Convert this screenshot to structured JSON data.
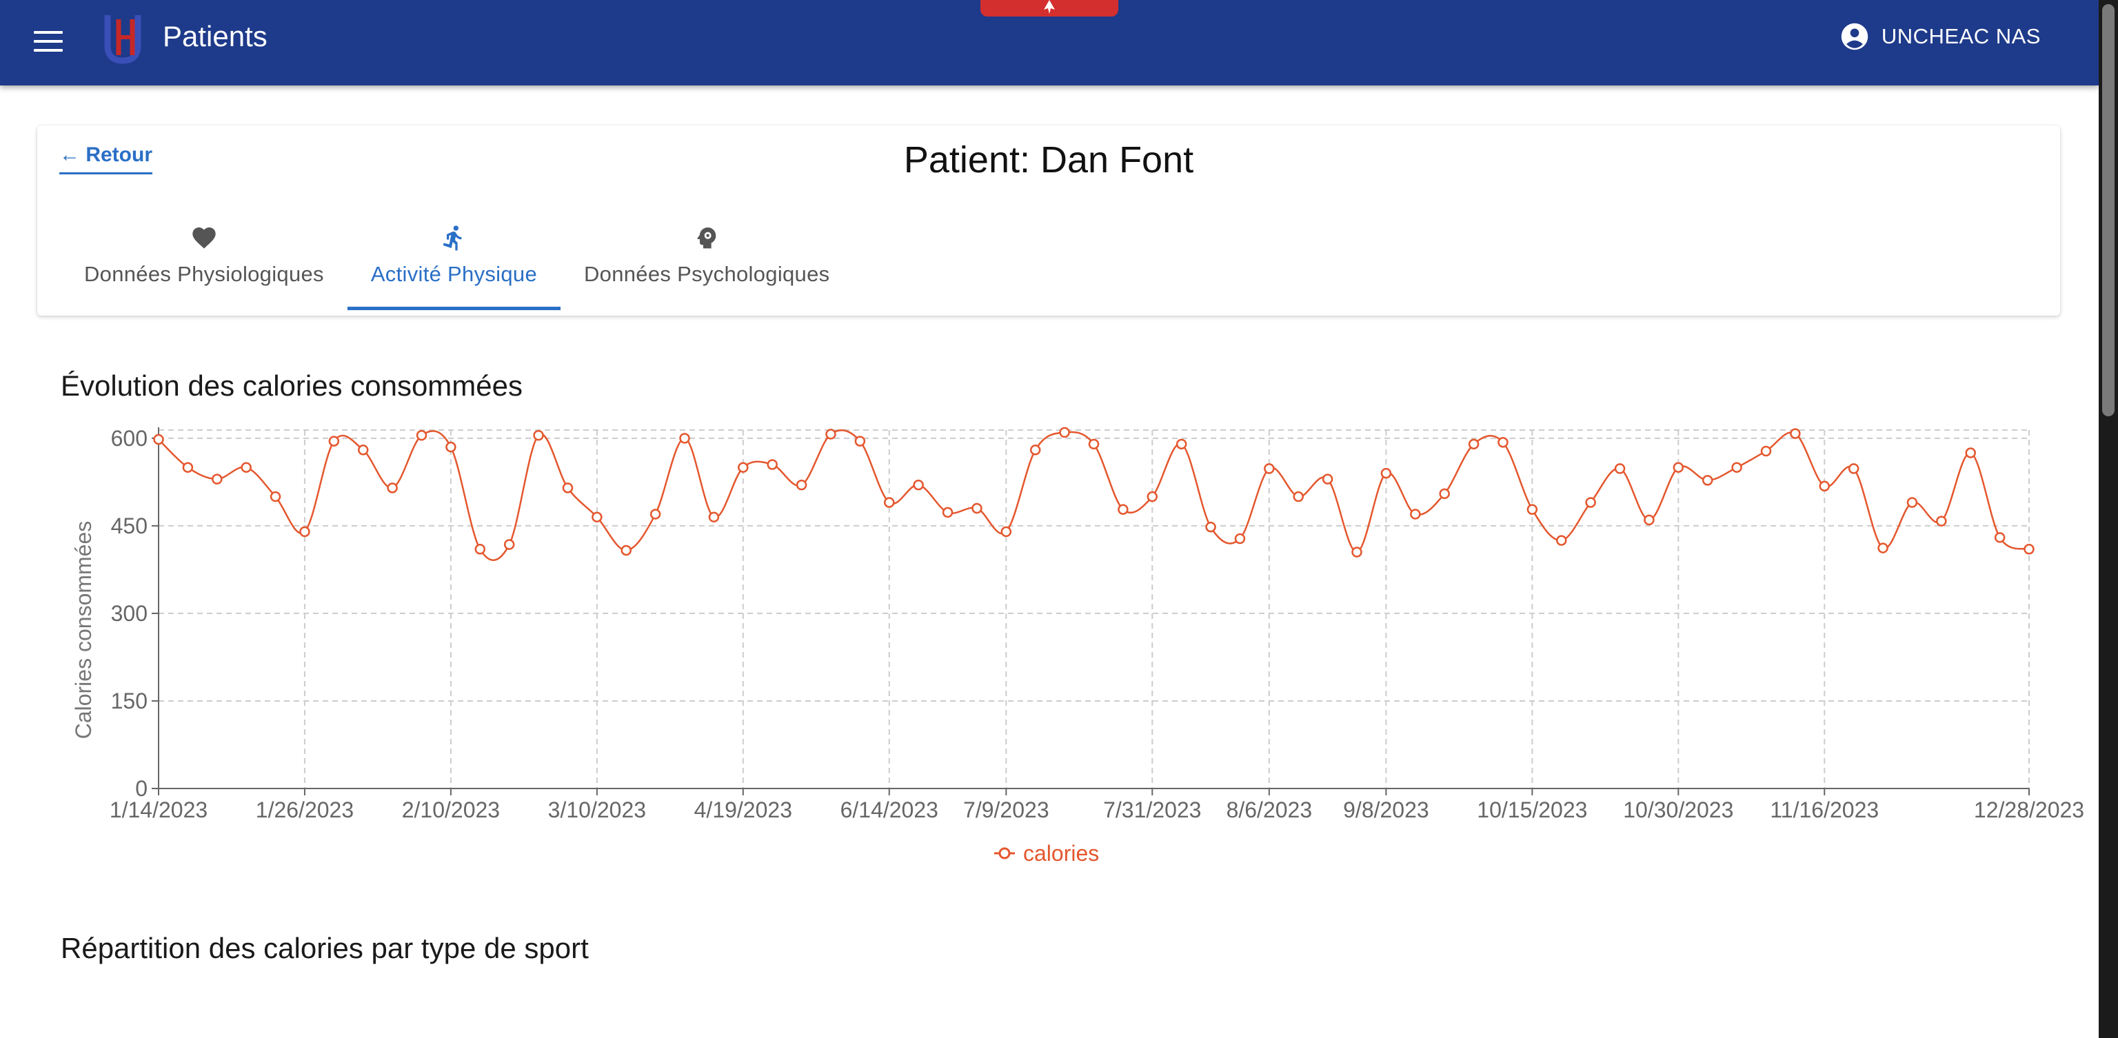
{
  "app": {
    "title": "Patients",
    "user_name": "UNCHEAC NAS",
    "bar_color": "#1e3a8a"
  },
  "header": {
    "back_label": "← Retour",
    "patient_title": "Patient: Dan Font",
    "tabs": [
      {
        "label": "Données Physiologiques",
        "icon": "heart-icon",
        "active": false
      },
      {
        "label": "Activité Physique",
        "icon": "running-icon",
        "active": true
      },
      {
        "label": "Données Psychologiques",
        "icon": "psychology-icon",
        "active": false
      }
    ]
  },
  "sections": {
    "calories_title": "Évolution des calories consommées",
    "sport_title": "Répartition des calories par type de sport"
  },
  "chart_data": {
    "type": "line",
    "title": "",
    "ylabel": "Calories consommées",
    "xlabel": "",
    "ylim": [
      0,
      614
    ],
    "yticks": [
      0,
      150,
      300,
      450,
      600
    ],
    "xtick_labels": [
      "1/14/2023",
      "1/26/2023",
      "2/10/2023",
      "3/10/2023",
      "4/19/2023",
      "6/14/2023",
      "7/9/2023",
      "7/31/2023",
      "8/6/2023",
      "9/8/2023",
      "10/15/2023",
      "10/30/2023",
      "11/16/2023",
      "12/28/2023"
    ],
    "grid": true,
    "legend": "bottom-center",
    "series": [
      {
        "name": "calories",
        "color": "#e4572e",
        "values": [
          598,
          550,
          530,
          550,
          500,
          440,
          595,
          580,
          515,
          605,
          585,
          410,
          418,
          605,
          515,
          465,
          408,
          470,
          600,
          465,
          550,
          555,
          520,
          607,
          595,
          490,
          520,
          473,
          480,
          440,
          580,
          610,
          590,
          478,
          500,
          590,
          448,
          428,
          548,
          500,
          530,
          405,
          540,
          470,
          505,
          590,
          593,
          478,
          425,
          490,
          548,
          460,
          550,
          528,
          550,
          578,
          608,
          518,
          548,
          412,
          490,
          458,
          575,
          430,
          410
        ]
      }
    ]
  }
}
